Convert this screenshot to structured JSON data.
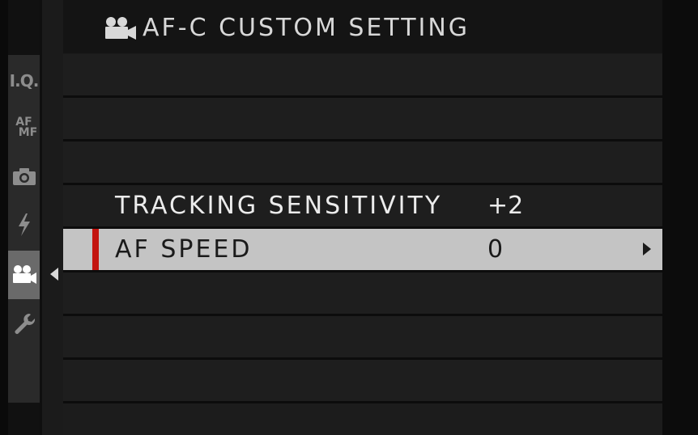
{
  "header": {
    "title": "AF-C CUSTOM SETTING",
    "icon": "movie-camera-icon"
  },
  "side_tabs": [
    {
      "name": "image-quality-tab",
      "label": "I.Q."
    },
    {
      "name": "af-mf-tab",
      "label_top": "AF",
      "label_bottom": "MF"
    },
    {
      "name": "shooting-setting-tab",
      "icon": "camera-icon"
    },
    {
      "name": "flash-setting-tab",
      "icon": "flash-icon"
    },
    {
      "name": "movie-setting-tab",
      "icon": "movie-camera-icon",
      "active": true
    },
    {
      "name": "setup-tab",
      "icon": "wrench-icon"
    }
  ],
  "menu": {
    "items": [
      {
        "label": "",
        "value": ""
      },
      {
        "label": "",
        "value": ""
      },
      {
        "label": "",
        "value": ""
      },
      {
        "label": "TRACKING SENSITIVITY",
        "value": "+2"
      },
      {
        "label": "AF SPEED",
        "value": "0",
        "selected": true
      },
      {
        "label": "",
        "value": ""
      },
      {
        "label": "",
        "value": ""
      },
      {
        "label": "",
        "value": ""
      }
    ]
  },
  "colors": {
    "selection_marker": "#c3130e",
    "selected_row": "#c4c4c4",
    "row_background": "#1e1e1e"
  }
}
